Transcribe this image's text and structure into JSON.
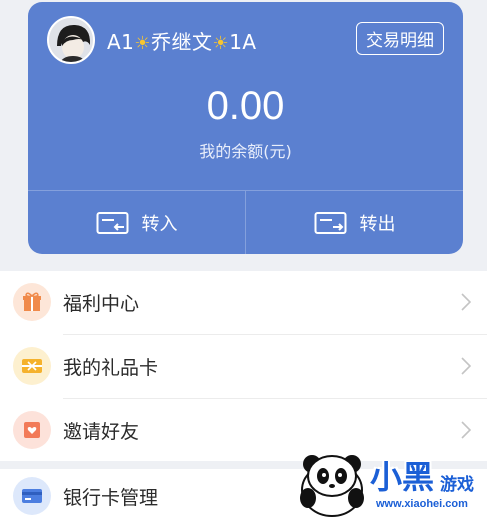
{
  "header": {
    "user_name_prefix": "A1",
    "user_name_middle": "乔继文",
    "user_name_suffix": "1A",
    "sun_glyph": "☀",
    "detail_label": "交易明细",
    "balance": "0.00",
    "balance_label": "我的余额(元)",
    "transfer_in_label": "转入",
    "transfer_out_label": "转出"
  },
  "menu": {
    "items": [
      {
        "label": "福利中心",
        "icon": "gift-icon",
        "color": "#f08a4b"
      },
      {
        "label": "我的礼品卡",
        "icon": "gift-card-icon",
        "color": "#f5b22d"
      },
      {
        "label": "邀请好友",
        "icon": "invite-icon",
        "color": "#f27a58"
      }
    ]
  },
  "bank": {
    "label": "银行卡管理",
    "icon": "bank-card-icon",
    "color": "#4c7ee0"
  },
  "watermark": {
    "title": "小黑",
    "subtitle": "游戏",
    "url": "www.xiaohei.com"
  },
  "colors": {
    "card": "#5b80d0",
    "background": "#eef0f4",
    "accent_text": "#1b5fd6"
  }
}
